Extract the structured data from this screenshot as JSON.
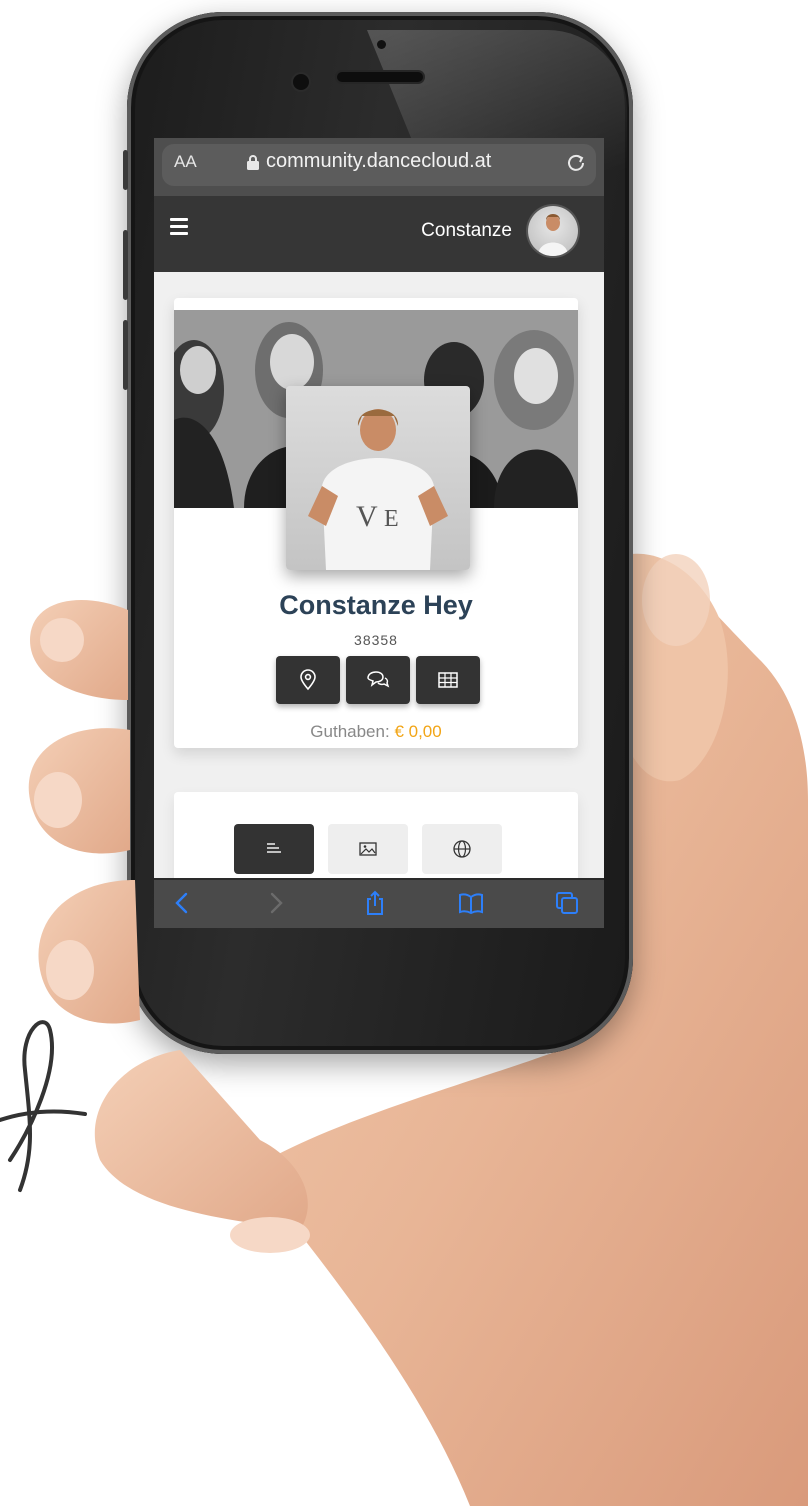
{
  "browser": {
    "text_size_label": "AA",
    "url": "community.dancecloud.at"
  },
  "appbar": {
    "user_name": "Constanze"
  },
  "profile": {
    "full_name": "Constanze Hey",
    "member_id": "38358",
    "balance_label": "Guthaben:",
    "balance_value": "€ 0,00",
    "actions": [
      {
        "icon": "location-pin-icon"
      },
      {
        "icon": "chat-bubbles-icon"
      },
      {
        "icon": "grid-table-icon"
      }
    ]
  },
  "tabs": [
    {
      "icon": "text-lines-icon",
      "active": true
    },
    {
      "icon": "image-icon",
      "active": false
    },
    {
      "icon": "globe-icon",
      "active": false
    }
  ],
  "safari_toolbar": {
    "icons": [
      "back-icon",
      "forward-icon",
      "share-icon",
      "bookmarks-icon",
      "tabs-icon"
    ]
  },
  "colors": {
    "name": "#2c4257",
    "balance_amount": "#f2a516",
    "app_bar": "#363636",
    "button": "#333333"
  }
}
